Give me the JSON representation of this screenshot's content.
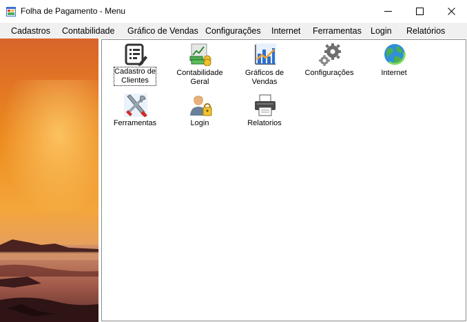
{
  "window": {
    "title": "Folha de Pagamento - Menu",
    "icon": "app-window-icon",
    "controls": [
      "minimize-icon",
      "maximize-icon",
      "close-icon"
    ]
  },
  "menu": {
    "items": [
      "Cadastros",
      "Contabilidade",
      "Gráfico de Vendas",
      "Configurações",
      "Internet",
      "Ferramentas",
      "Login",
      "Relatórios"
    ]
  },
  "tiles": [
    {
      "line1": "Cadastro de",
      "line2": "Clientes",
      "icon": "client-form-icon",
      "selected": true
    },
    {
      "line1": "Contabilidade",
      "line2": "Geral",
      "icon": "money-chart-icon",
      "selected": false
    },
    {
      "line1": "Gráficos de",
      "line2": "Vendas",
      "icon": "bar-chart-icon",
      "selected": false
    },
    {
      "line1": "Configurações",
      "line2": "",
      "icon": "gears-icon",
      "selected": false
    },
    {
      "line1": "Internet",
      "line2": "",
      "icon": "globe-icon",
      "selected": false
    },
    {
      "line1": "Ferramentas",
      "line2": "",
      "icon": "tools-icon",
      "selected": false
    },
    {
      "line1": "Login",
      "line2": "",
      "icon": "user-lock-icon",
      "selected": false
    },
    {
      "line1": "Relatorios",
      "line2": "",
      "icon": "printer-icon",
      "selected": false
    }
  ],
  "colors": {
    "menubar_bg": "#f0f0f0",
    "panel_border": "#8a8a8a",
    "sunset_sky": "#e8801e",
    "sunset_water": "#b06b52"
  }
}
